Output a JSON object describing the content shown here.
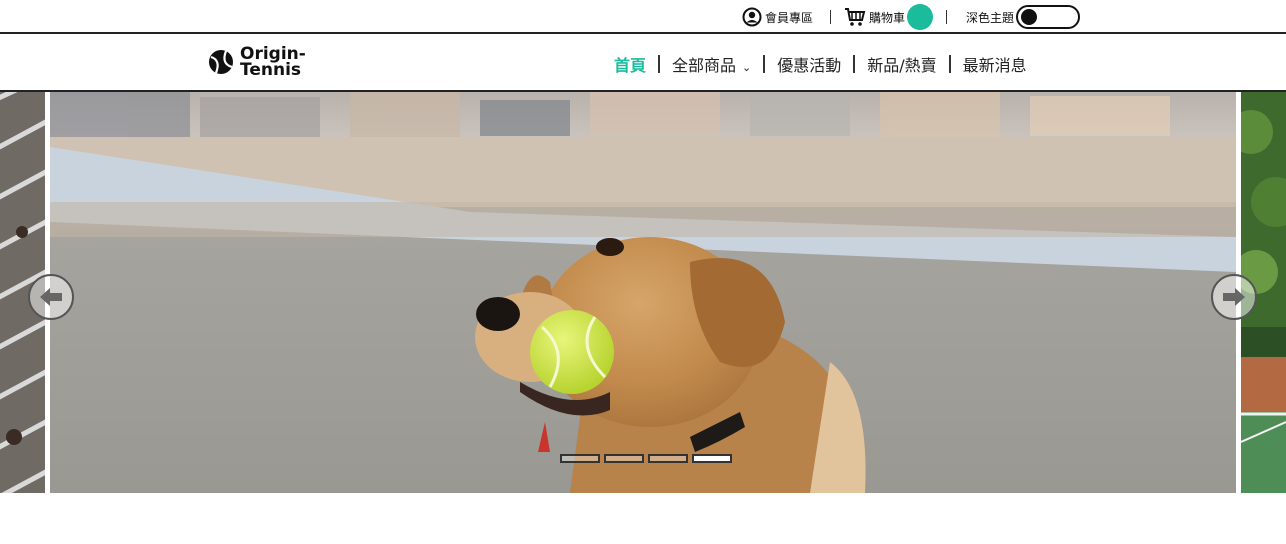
{
  "topbar": {
    "member_label": "會員專區",
    "cart_label": "購物車",
    "theme_label": "深色主題"
  },
  "brand": {
    "line1": "Origin-",
    "line2": "Tennis"
  },
  "nav": {
    "items": [
      "首頁",
      "全部商品",
      "優惠活動",
      "新品/熱賣",
      "最新消息"
    ]
  },
  "carousel": {
    "slides_count": 4,
    "active_index": 3
  },
  "colors": {
    "accent": "#1abc9c",
    "border": "#222222"
  },
  "icons": [
    "user-circle-icon",
    "cart-icon",
    "chevron-down-icon",
    "arrow-left-icon",
    "arrow-right-icon",
    "tennis-ball-logo-icon"
  ]
}
